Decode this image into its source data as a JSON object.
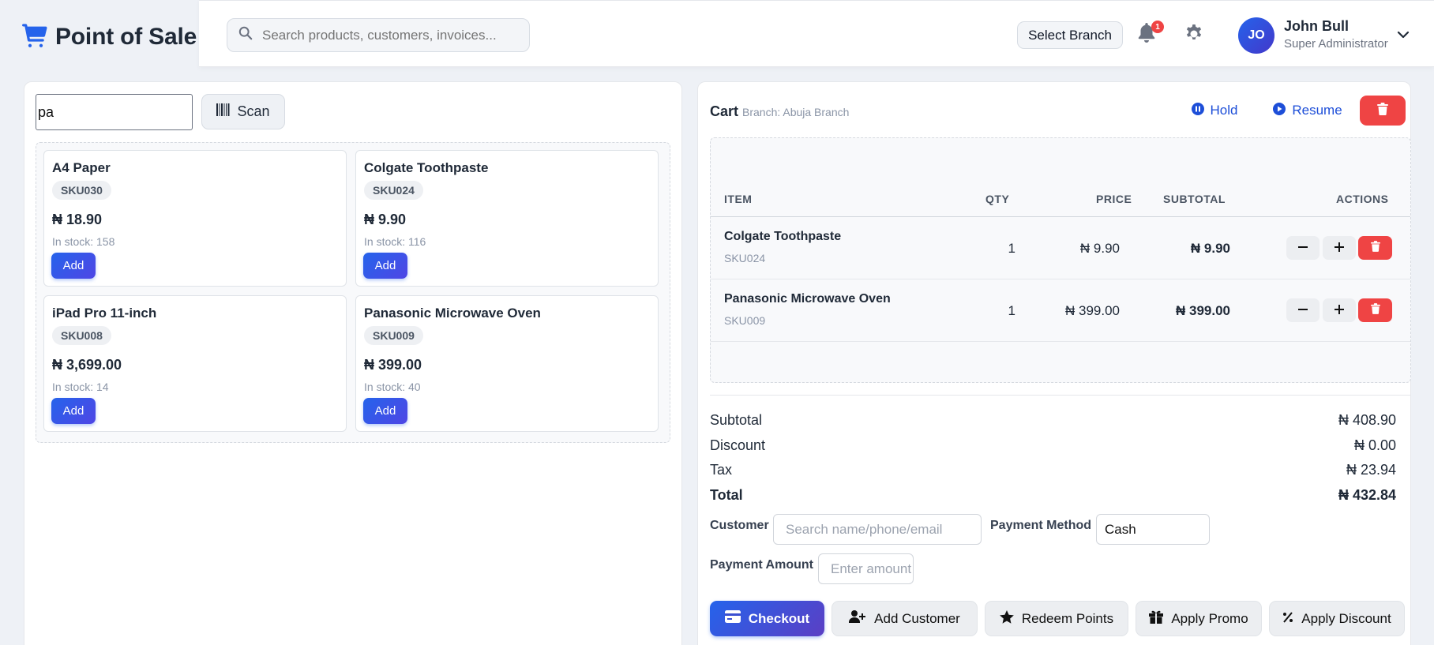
{
  "brand": {
    "title": "Point of Sale",
    "icon": "cart-icon"
  },
  "header": {
    "search_placeholder": "Search products, customers, invoices...",
    "branch_button": "Select Branch",
    "notification_count": "1",
    "user": {
      "initials": "JO",
      "name": "John Bull",
      "role": "Super Administrator"
    }
  },
  "products": {
    "search_value": "pa",
    "scan_label": "Scan",
    "items": [
      {
        "name": "A4 Paper",
        "sku": "SKU030",
        "price": "₦ 18.90",
        "stock": "In stock: 158",
        "add": "Add"
      },
      {
        "name": "Colgate Toothpaste",
        "sku": "SKU024",
        "price": "₦ 9.90",
        "stock": "In stock: 116",
        "add": "Add"
      },
      {
        "name": "iPad Pro 11-inch",
        "sku": "SKU008",
        "price": "₦ 3,699.00",
        "stock": "In stock: 14",
        "add": "Add"
      },
      {
        "name": "Panasonic Microwave Oven",
        "sku": "SKU009",
        "price": "₦ 399.00",
        "stock": "In stock: 40",
        "add": "Add"
      }
    ]
  },
  "cart": {
    "title": "Cart",
    "branch": "Branch: Abuja Branch",
    "hold": "Hold",
    "resume": "Resume",
    "columns": {
      "item": "ITEM",
      "qty": "QTY",
      "price": "PRICE",
      "subtotal": "SUBTOTAL",
      "actions": "ACTIONS"
    },
    "rows": [
      {
        "name": "Colgate Toothpaste",
        "sku": "SKU024",
        "qty": "1",
        "price": "₦ 9.90",
        "subtotal": "₦ 9.90"
      },
      {
        "name": "Panasonic Microwave Oven",
        "sku": "SKU009",
        "qty": "1",
        "price": "₦ 399.00",
        "subtotal": "₦ 399.00"
      }
    ],
    "summary": {
      "subtotal_label": "Subtotal",
      "subtotal": "₦ 408.90",
      "discount_label": "Discount",
      "discount": "₦ 0.00",
      "tax_label": "Tax",
      "tax": "₦ 23.94",
      "total_label": "Total",
      "total": "₦ 432.84"
    },
    "form": {
      "customer_label": "Customer",
      "customer_placeholder": "Search name/phone/email",
      "payment_method_label": "Payment Method",
      "payment_method_value": "Cash",
      "payment_amount_label": "Payment Amount",
      "payment_amount_placeholder": "Enter amount"
    },
    "actions": {
      "checkout": "Checkout",
      "add_customer": "Add Customer",
      "redeem_points": "Redeem Points",
      "apply_promo": "Apply Promo",
      "apply_discount": "Apply Discount"
    }
  },
  "colors": {
    "primary": "#2563eb",
    "danger": "#ef4444",
    "link": "#1d4ed8"
  }
}
